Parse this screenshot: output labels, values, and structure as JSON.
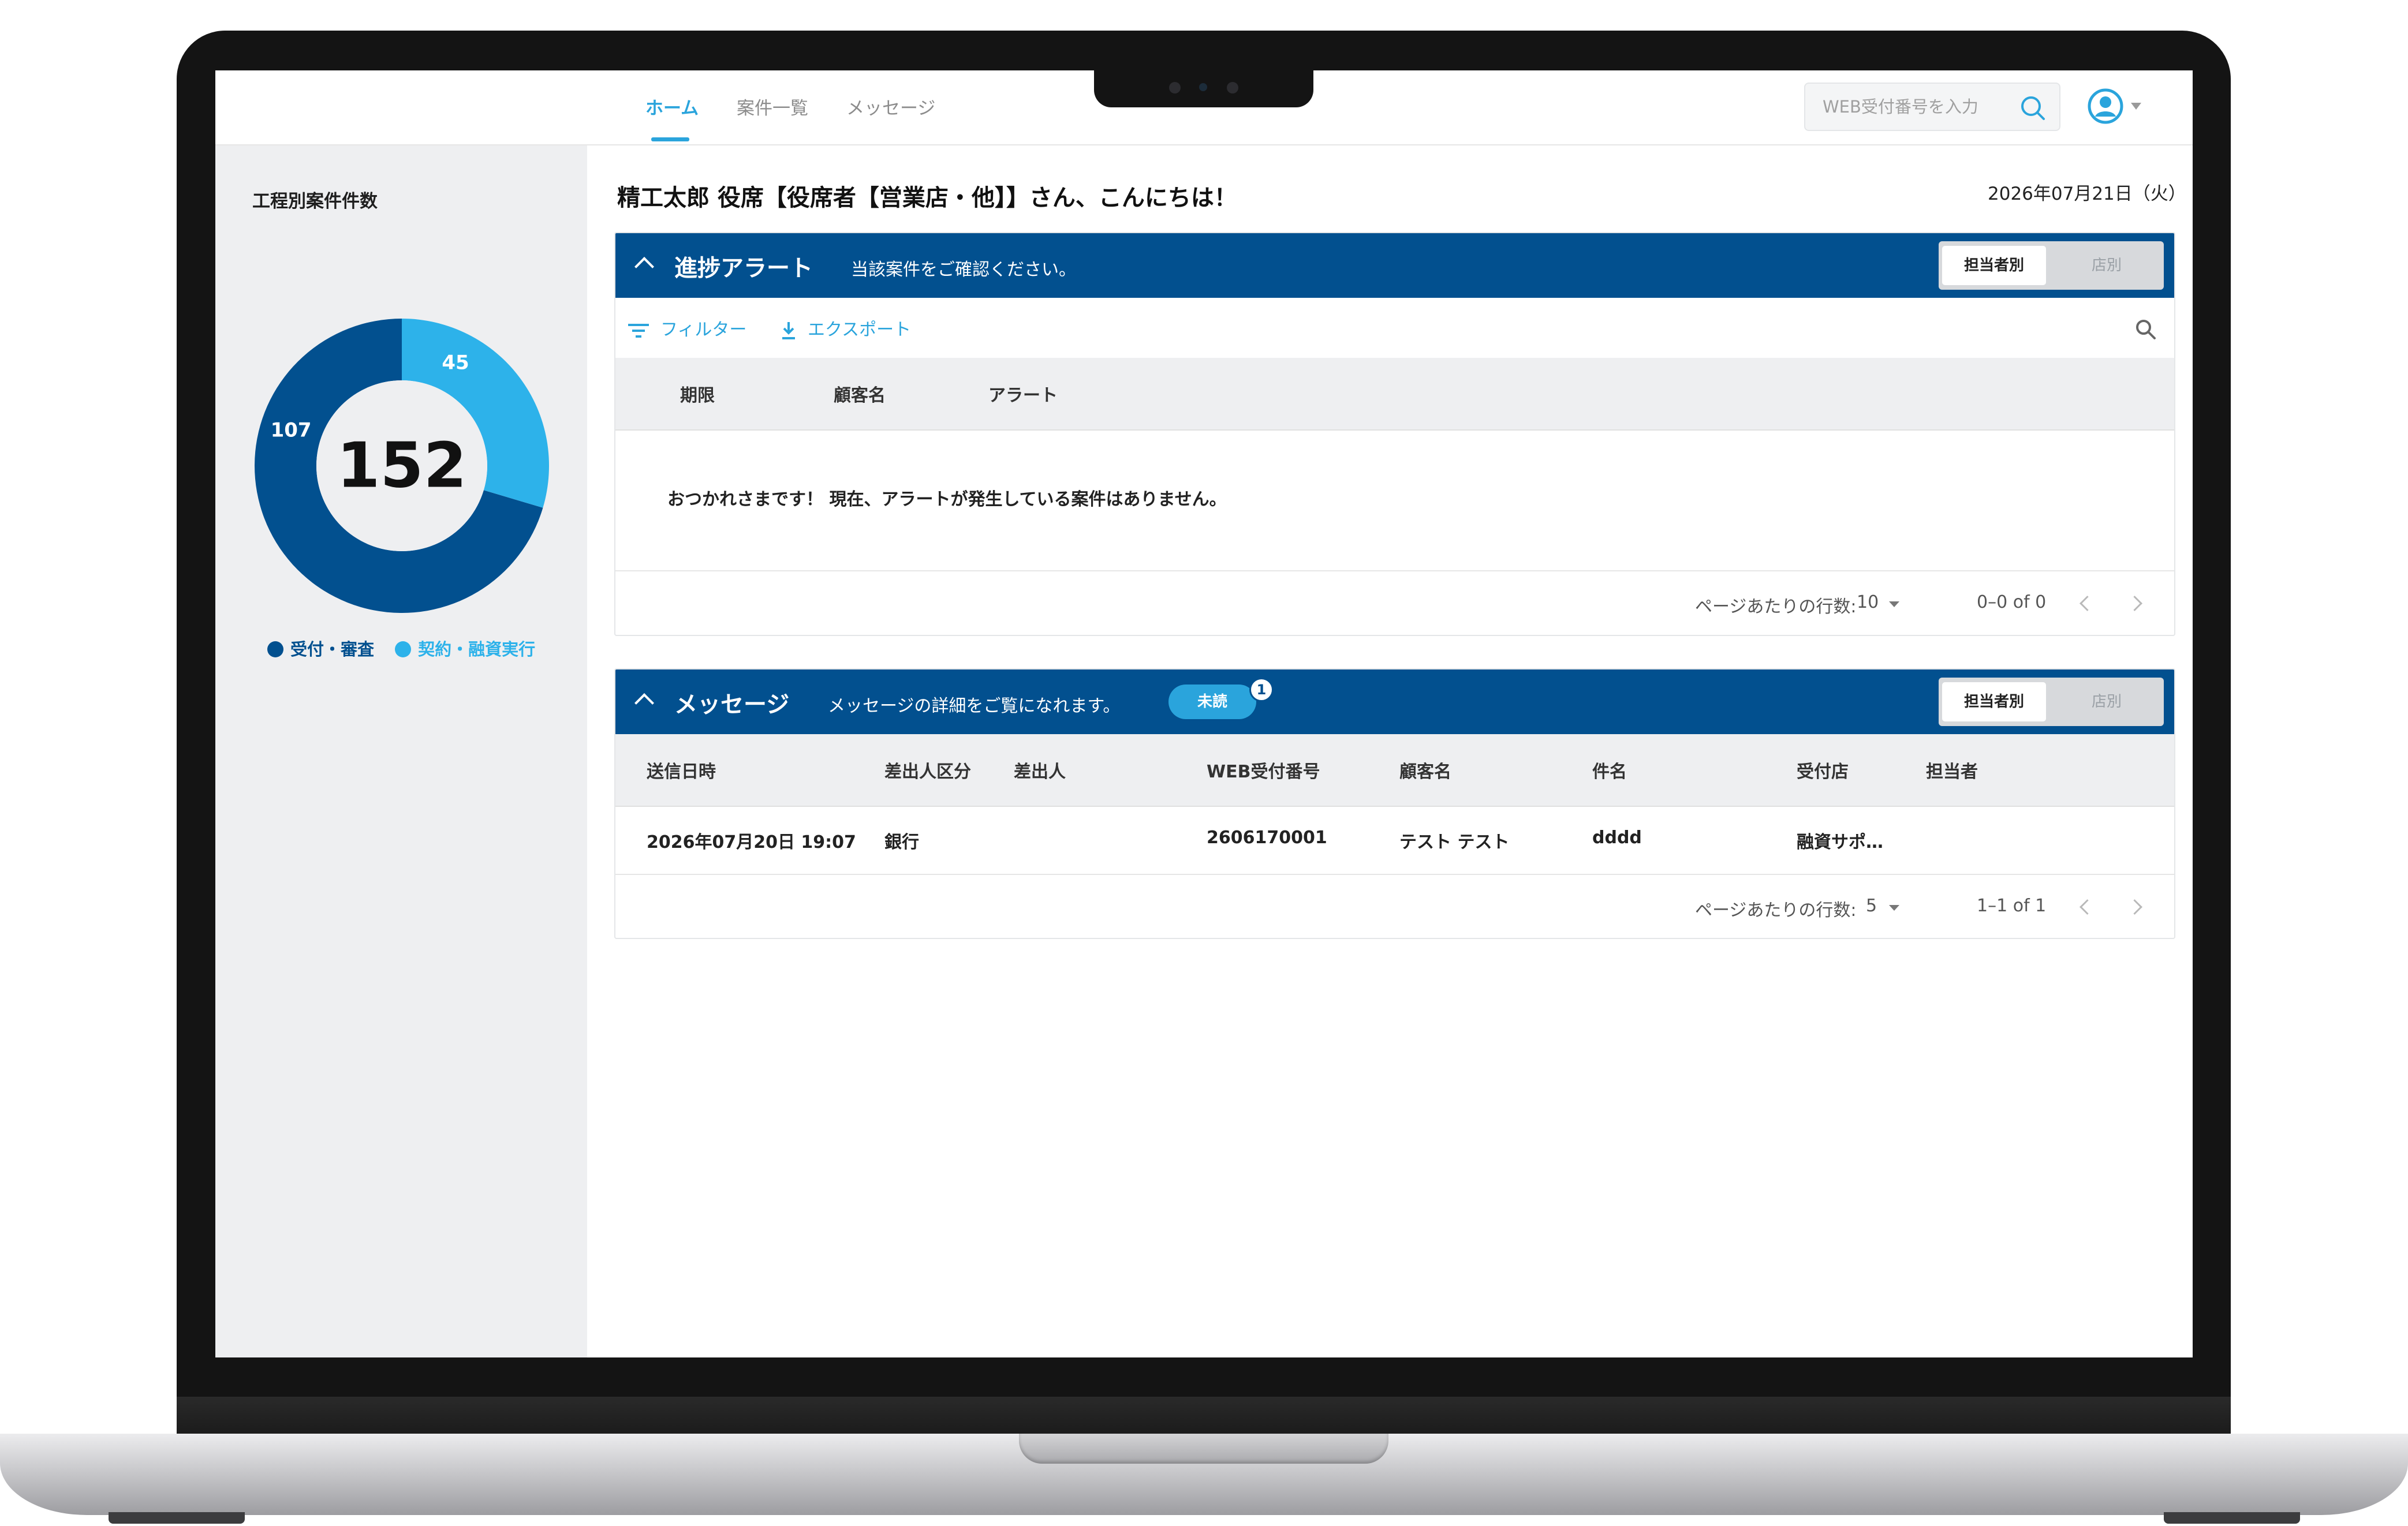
{
  "nav": {
    "tabs": [
      {
        "label": "ホーム",
        "active": true
      },
      {
        "label": "案件一覧",
        "active": false
      },
      {
        "label": "メッセージ",
        "active": false
      }
    ],
    "search_placeholder": "WEB受付番号を入力",
    "search_icon": "search-icon",
    "user_icon": "user-account-icon"
  },
  "sidebar": {
    "title": "工程別案件件数",
    "donut": {
      "total": "152",
      "segments": [
        {
          "label": "受付・審査",
          "value": 107,
          "color": "#02508f"
        },
        {
          "label": "契約・融資実行",
          "value": 45,
          "color": "#2db2ea"
        }
      ]
    }
  },
  "main": {
    "greeting": "精工太郎 役席【役席者【営業店・他】】さん、こんにちは！",
    "date": "2026年07月21日（火）"
  },
  "alert_card": {
    "title": "進捗アラート",
    "subtitle": "当該案件をご確認ください。",
    "toggle": {
      "on": "担当者別",
      "off": "店別"
    },
    "filter_label": "フィルター",
    "export_label": "エクスポート",
    "columns": [
      "期限",
      "顧客名",
      "アラート"
    ],
    "empty_message": "おつかれさまです！ 現在、アラートが発生している案件はありません。",
    "pager": {
      "label": "ページあたりの行数:",
      "size": "10",
      "range": "0–0 of 0"
    }
  },
  "message_card": {
    "title": "メッセージ",
    "subtitle": "メッセージの詳細をご覧になれます。",
    "unread_label": "未読",
    "unread_count": "1",
    "toggle": {
      "on": "担当者別",
      "off": "店別"
    },
    "columns": [
      "送信日時",
      "差出人区分",
      "差出人",
      "WEB受付番号",
      "顧客名",
      "件名",
      "受付店",
      "担当者"
    ],
    "rows": [
      [
        "2026年07月20日 19:07",
        "銀行",
        "",
        "2606170001",
        "テスト テスト",
        "dddd",
        "融資サポ…",
        ""
      ]
    ],
    "pager": {
      "label": "ページあたりの行数:",
      "size": "5",
      "range": "1–1 of 1"
    }
  },
  "colors": {
    "header_blue": "#02508f",
    "accent": "#2aa4dc",
    "sidebar_bg": "#eeeff1"
  }
}
